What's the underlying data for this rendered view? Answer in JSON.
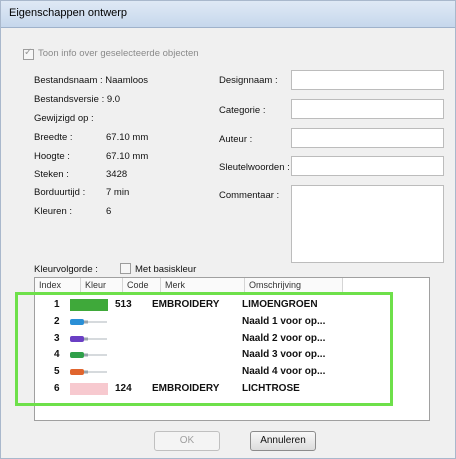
{
  "window": {
    "title": "Eigenschappen ontwerp"
  },
  "info_checkbox": {
    "label": "Toon info over geselecteerde objecten",
    "checked": true
  },
  "info": {
    "bestandsnaam": "Bestandsnaam : Naamloos",
    "bestandsversie": "Bestandsversie : 9.0",
    "gewijzigd": "Gewijzigd op :",
    "breedte_label": "Breedte :",
    "breedte_value": "67.10 mm",
    "hoogte_label": "Hoogte :",
    "hoogte_value": "67.10 mm",
    "steken_label": "Steken :",
    "steken_value": "3428",
    "borduurtijd_label": "Borduurtijd :",
    "borduurtijd_value": "7 min",
    "kleuren_label": "Kleuren :",
    "kleuren_value": "6"
  },
  "fields": {
    "designnaam": "Designnaam :",
    "categorie": "Categorie :",
    "auteur": "Auteur :",
    "sleutelwoorden": "Sleutelwoorden :",
    "commentaar": "Commentaar :"
  },
  "kleurvolgorde": {
    "label": "Kleurvolgorde :",
    "basiskleur_label": "Met basiskleur",
    "basiskleur_checked": false
  },
  "list": {
    "headers": [
      "Index",
      "Kleur",
      "Code",
      "Merk",
      "Omschrijving"
    ],
    "rows": [
      {
        "index": "1",
        "kind": "swatch",
        "color": "#3fa93a",
        "code": "513",
        "merk": "EMBROIDERY",
        "omschrijving": "LIMOENGROEN"
      },
      {
        "index": "2",
        "kind": "needle",
        "color": "#2a8fd6",
        "code": "",
        "merk": "",
        "omschrijving": "Naald 1 voor op..."
      },
      {
        "index": "3",
        "kind": "needle",
        "color": "#6a3fc4",
        "code": "",
        "merk": "",
        "omschrijving": "Naald 2 voor op..."
      },
      {
        "index": "4",
        "kind": "needle",
        "color": "#2fa04a",
        "code": "",
        "merk": "",
        "omschrijving": "Naald 3 voor op..."
      },
      {
        "index": "5",
        "kind": "needle",
        "color": "#e0652e",
        "code": "",
        "merk": "",
        "omschrijving": "Naald 4 voor op..."
      },
      {
        "index": "6",
        "kind": "swatch",
        "color": "#f7c9cf",
        "code": "124",
        "merk": "EMBROIDERY",
        "omschrijving": "LICHTROSE"
      }
    ]
  },
  "buttons": {
    "ok": "OK",
    "annuleren": "Annuleren"
  }
}
